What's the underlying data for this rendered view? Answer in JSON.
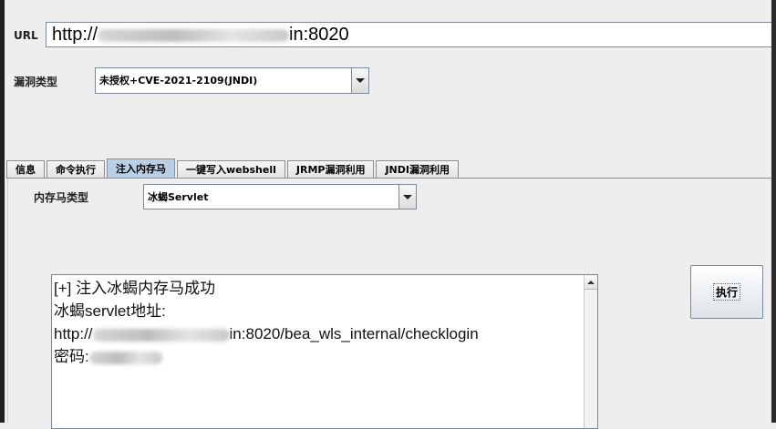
{
  "form": {
    "url_label": "URL",
    "url_prefix": "http://",
    "url_suffix": "in:8020",
    "vuln_type_label": "漏洞类型",
    "vuln_type_value": "未授权+CVE-2021-2109(JNDI)"
  },
  "tabs": [
    {
      "label": "信息"
    },
    {
      "label": "命令执行"
    },
    {
      "label": "注入内存马"
    },
    {
      "label": "一键写入webshell"
    },
    {
      "label": "JRMP漏洞利用"
    },
    {
      "label": "JNDI漏洞利用"
    }
  ],
  "active_tab": "注入内存马",
  "inject": {
    "memshell_type_label": "内存马类型",
    "memshell_type_value": "冰蝎Servlet",
    "execute_label": "执行",
    "output": {
      "line1": "[+] 注入冰蝎内存马成功",
      "line2": "冰蝎servlet地址:",
      "line3_prefix": "http://",
      "line3_suffix": "in:8020/bea_wls_internal/checklogin",
      "line4_prefix": "密码:"
    }
  },
  "icons": {
    "combo_arrow": "chevron-down-icon",
    "scroll_up": "arrow-up-icon"
  }
}
